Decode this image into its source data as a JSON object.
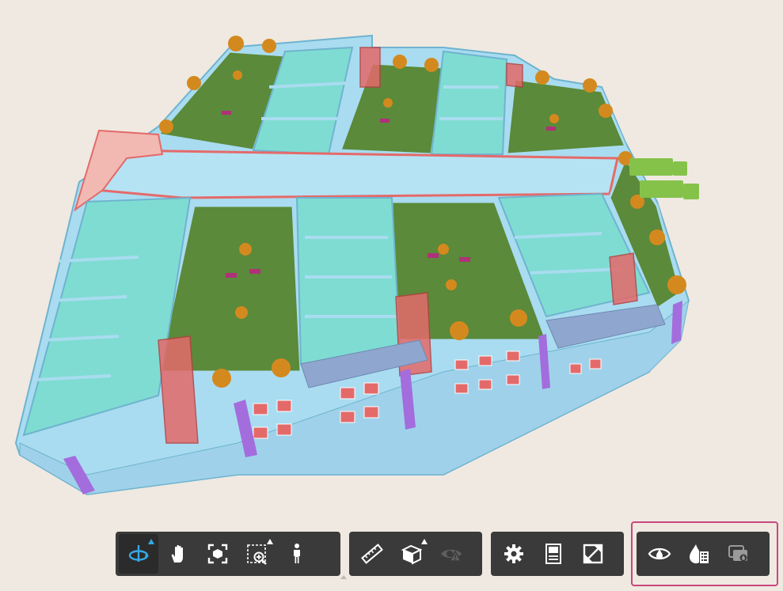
{
  "viewer": {
    "background_color": "#efe9e1",
    "model_colors": {
      "walls": "#a9dcf0",
      "floors": "#7fdcd2",
      "roof_garden": "#5a8a3a",
      "glazing": "#e46a6a",
      "columns": "#a36ddd",
      "trees": "#d4891e",
      "trucks": "#85c24a"
    }
  },
  "toolbar": {
    "accent_color": "#35a9e6",
    "highlight_color": "#c8487e",
    "groups": [
      {
        "name": "navigation",
        "tools": [
          {
            "icon": "orbit-icon",
            "active": true,
            "has_flyout": true
          },
          {
            "icon": "pan-icon",
            "active": false,
            "has_flyout": false
          },
          {
            "icon": "fit-to-view-icon",
            "active": false,
            "has_flyout": false
          },
          {
            "icon": "zoom-window-icon",
            "active": false,
            "has_flyout": true
          },
          {
            "icon": "first-person-icon",
            "active": false,
            "has_flyout": false
          }
        ]
      },
      {
        "name": "modeling",
        "tools": [
          {
            "icon": "measure-icon",
            "active": false,
            "has_flyout": false
          },
          {
            "icon": "section-icon",
            "active": false,
            "has_flyout": true
          },
          {
            "icon": "explode-icon",
            "active": false,
            "disabled": true
          }
        ]
      },
      {
        "name": "settings",
        "tools": [
          {
            "icon": "settings-icon",
            "active": false
          },
          {
            "icon": "properties-icon",
            "active": false
          },
          {
            "icon": "fullscreen-icon",
            "active": false
          }
        ]
      },
      {
        "name": "extensions",
        "highlighted": true,
        "tools": [
          {
            "icon": "isolate-visibility-icon",
            "active": false
          },
          {
            "icon": "color-by-property-icon",
            "active": false
          },
          {
            "icon": "ghosting-icon",
            "active": false
          }
        ]
      }
    ]
  }
}
